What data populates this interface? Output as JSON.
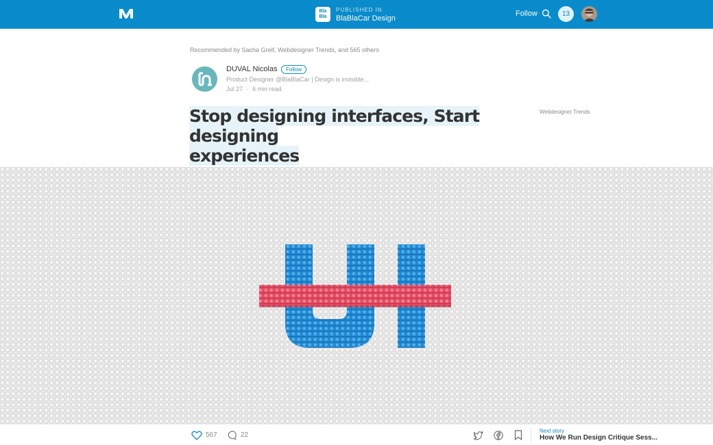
{
  "colors": {
    "brand": "#0a8ccc",
    "legoBlue": "#1786d0",
    "legoPink": "#e4506a",
    "highlight": "#e6f4fa",
    "avatarTeal": "#66b8bd"
  },
  "header": {
    "logo_icon": "medium-logo-icon",
    "publication": {
      "label": "PUBLISHED IN",
      "name": "BlaBlaCar Design",
      "logo_line1": "Bla",
      "logo_line2": "Bla"
    },
    "follow_label": "Follow",
    "search_icon": "search-icon",
    "notification_count": "13",
    "avatar_icon": "user-avatar-icon"
  },
  "article": {
    "recommended": "Recommended by Sacha Greif, Webdesigner Trends, and 565 others",
    "author": {
      "name": "DUVAL Nicolas",
      "follow_label": "Follow",
      "bio": "Product Designer @BlaBlaCar | Design is invisible...",
      "date": "Jul 27",
      "separator": "·",
      "read_time": "6 min read"
    },
    "title_line1": "Stop designing interfaces, Start designing",
    "title_line2": "experiences",
    "side_note": "Webdesigner Trends"
  },
  "footer": {
    "likes": "567",
    "comments": "22",
    "next_label": "Next story",
    "next_title": "How We Run Design Critique Sess..."
  }
}
